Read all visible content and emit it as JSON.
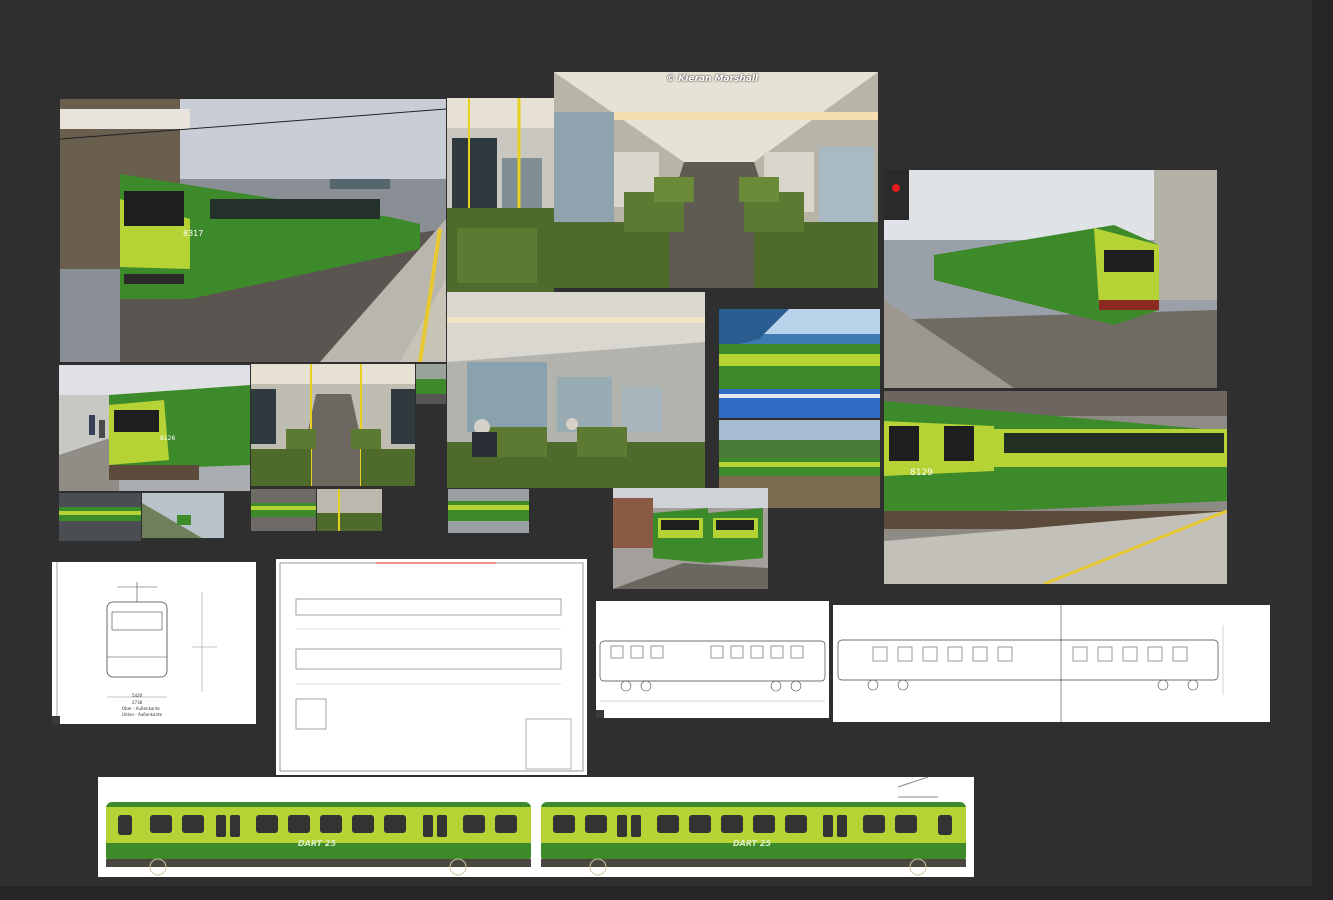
{
  "board": {
    "photo_credit": "© Kieran Marshall",
    "unit_numbers": [
      "8317",
      "8126",
      "8129"
    ],
    "drawing_labels": [
      "5420",
      "2738",
      "Ober - Außenkante",
      "Unten - Außenkante"
    ],
    "livery_text": "DART 25",
    "colors": {
      "background": "#2f2f2f",
      "dart_green": "#3d8a2a",
      "dart_lime": "#b5d334",
      "seat_green": "#4e6b2c"
    }
  }
}
